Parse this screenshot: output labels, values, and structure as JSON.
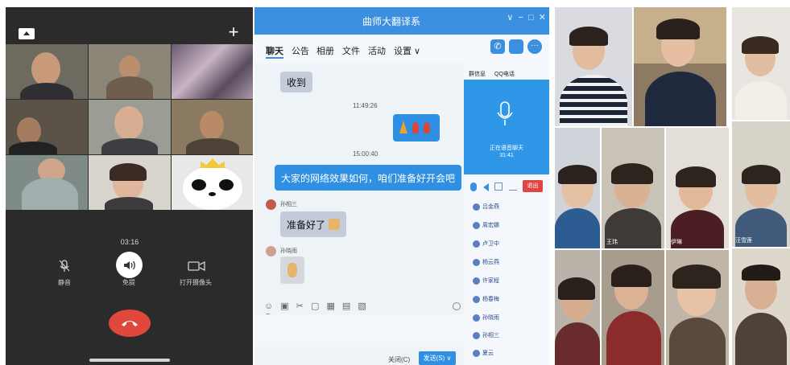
{
  "phone": {
    "duration": "03:16",
    "mute_label": "静音",
    "speaker_label": "免提",
    "camera_label": "打开摄像头",
    "add_icon": "plus-icon",
    "minimize_icon": "minimize-icon"
  },
  "qq": {
    "window_title": "曲师大翻译系",
    "tabs": [
      "聊天",
      "公告",
      "相册",
      "文件",
      "活动",
      "设置 ∨"
    ],
    "messages": [
      {
        "type": "bubble-gray",
        "text": "收到"
      },
      {
        "type": "time",
        "text": "11:49:26"
      },
      {
        "type": "time",
        "text": "15:00:40"
      },
      {
        "type": "bubble-blue",
        "text": "大家的网络效果如何，咱们准备好开会吧"
      },
      {
        "type": "sender",
        "text": "孙相三"
      },
      {
        "type": "bubble-gray",
        "text": "准备好了"
      },
      {
        "type": "sender",
        "text": "孙晓雨"
      }
    ],
    "side_tabs": [
      "群信息",
      "QQ电话"
    ],
    "call_status": "正在语音聊天",
    "call_time": "31:41",
    "exit_label": "退出",
    "members": [
      "吕金燕",
      "周宏娜",
      "卢卫中",
      "杨云燕",
      "许家程",
      "杨春梅",
      "孙晓雨",
      "孙相三",
      "夏云"
    ],
    "close_label": "关闭(C)",
    "send_label": "发送(S) ∨"
  },
  "gallery": {
    "names": [
      "王玮",
      "伊琳",
      "汪雪莲"
    ]
  }
}
